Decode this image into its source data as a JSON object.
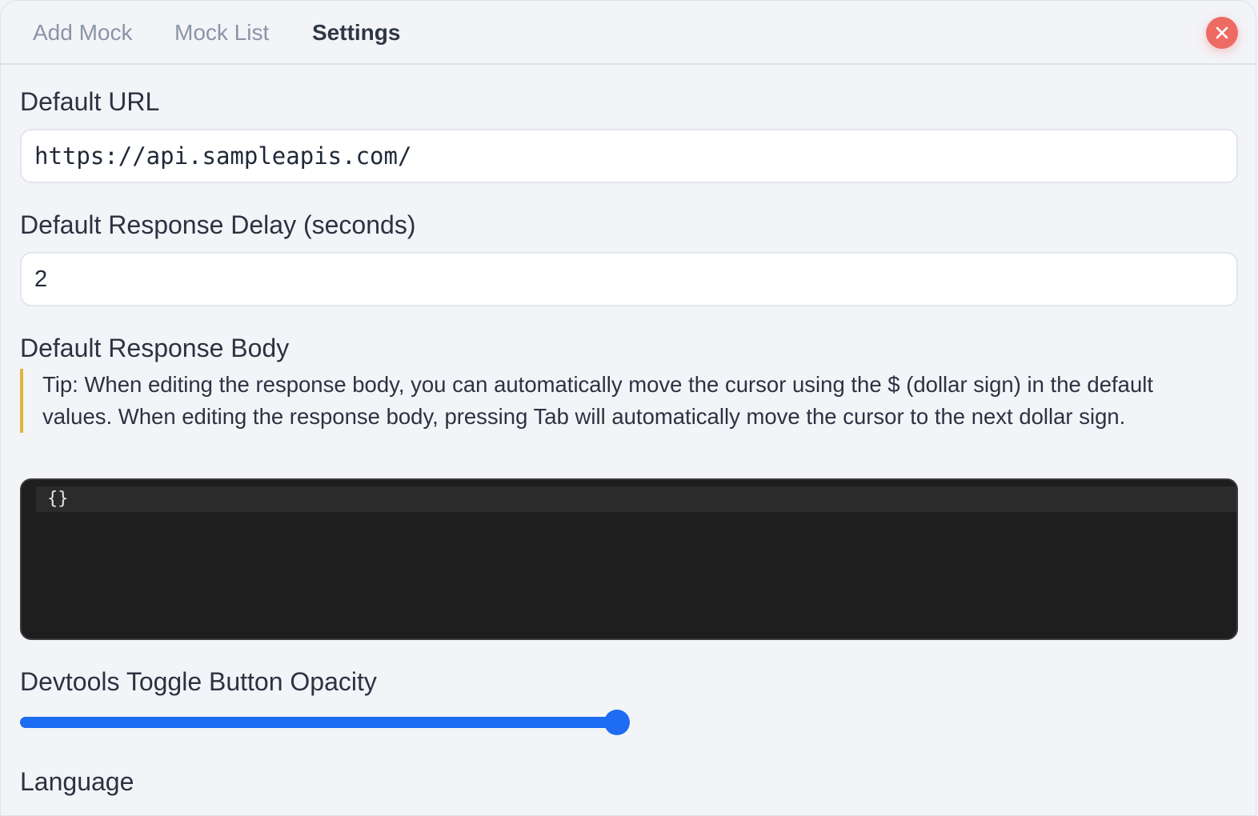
{
  "tabs": [
    {
      "label": "Add Mock",
      "active": false
    },
    {
      "label": "Mock List",
      "active": false
    },
    {
      "label": "Settings",
      "active": true
    }
  ],
  "close_button": {
    "icon": "close-icon",
    "color": "#ee6b63"
  },
  "settings": {
    "default_url": {
      "label": "Default URL",
      "value": "https://api.sampleapis.com/"
    },
    "response_delay": {
      "label": "Default Response Delay (seconds)",
      "value": "2"
    },
    "response_body": {
      "label": "Default Response Body",
      "tip": "Tip: When editing the response body, you can automatically move the cursor using the $ (dollar sign) in the default values. When editing the response body, pressing Tab will automatically move the cursor to the next dollar sign.",
      "code": "{}"
    },
    "toggle_opacity": {
      "label": "Devtools Toggle Button Opacity",
      "value": 1.0,
      "accent": "#1d6cf2"
    },
    "language": {
      "label": "Language"
    }
  }
}
